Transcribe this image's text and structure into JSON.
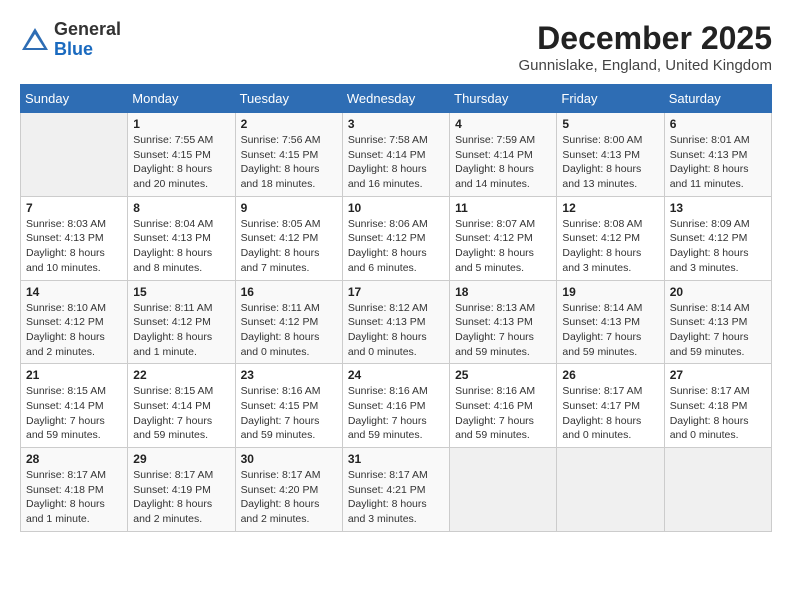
{
  "header": {
    "logo_line1": "General",
    "logo_line2": "Blue",
    "month": "December 2025",
    "location": "Gunnislake, England, United Kingdom"
  },
  "weekdays": [
    "Sunday",
    "Monday",
    "Tuesday",
    "Wednesday",
    "Thursday",
    "Friday",
    "Saturday"
  ],
  "weeks": [
    [
      {
        "day": "",
        "info": ""
      },
      {
        "day": "1",
        "info": "Sunrise: 7:55 AM\nSunset: 4:15 PM\nDaylight: 8 hours\nand 20 minutes."
      },
      {
        "day": "2",
        "info": "Sunrise: 7:56 AM\nSunset: 4:15 PM\nDaylight: 8 hours\nand 18 minutes."
      },
      {
        "day": "3",
        "info": "Sunrise: 7:58 AM\nSunset: 4:14 PM\nDaylight: 8 hours\nand 16 minutes."
      },
      {
        "day": "4",
        "info": "Sunrise: 7:59 AM\nSunset: 4:14 PM\nDaylight: 8 hours\nand 14 minutes."
      },
      {
        "day": "5",
        "info": "Sunrise: 8:00 AM\nSunset: 4:13 PM\nDaylight: 8 hours\nand 13 minutes."
      },
      {
        "day": "6",
        "info": "Sunrise: 8:01 AM\nSunset: 4:13 PM\nDaylight: 8 hours\nand 11 minutes."
      }
    ],
    [
      {
        "day": "7",
        "info": "Sunrise: 8:03 AM\nSunset: 4:13 PM\nDaylight: 8 hours\nand 10 minutes."
      },
      {
        "day": "8",
        "info": "Sunrise: 8:04 AM\nSunset: 4:13 PM\nDaylight: 8 hours\nand 8 minutes."
      },
      {
        "day": "9",
        "info": "Sunrise: 8:05 AM\nSunset: 4:12 PM\nDaylight: 8 hours\nand 7 minutes."
      },
      {
        "day": "10",
        "info": "Sunrise: 8:06 AM\nSunset: 4:12 PM\nDaylight: 8 hours\nand 6 minutes."
      },
      {
        "day": "11",
        "info": "Sunrise: 8:07 AM\nSunset: 4:12 PM\nDaylight: 8 hours\nand 5 minutes."
      },
      {
        "day": "12",
        "info": "Sunrise: 8:08 AM\nSunset: 4:12 PM\nDaylight: 8 hours\nand 3 minutes."
      },
      {
        "day": "13",
        "info": "Sunrise: 8:09 AM\nSunset: 4:12 PM\nDaylight: 8 hours\nand 3 minutes."
      }
    ],
    [
      {
        "day": "14",
        "info": "Sunrise: 8:10 AM\nSunset: 4:12 PM\nDaylight: 8 hours\nand 2 minutes."
      },
      {
        "day": "15",
        "info": "Sunrise: 8:11 AM\nSunset: 4:12 PM\nDaylight: 8 hours\nand 1 minute."
      },
      {
        "day": "16",
        "info": "Sunrise: 8:11 AM\nSunset: 4:12 PM\nDaylight: 8 hours\nand 0 minutes."
      },
      {
        "day": "17",
        "info": "Sunrise: 8:12 AM\nSunset: 4:13 PM\nDaylight: 8 hours\nand 0 minutes."
      },
      {
        "day": "18",
        "info": "Sunrise: 8:13 AM\nSunset: 4:13 PM\nDaylight: 7 hours\nand 59 minutes."
      },
      {
        "day": "19",
        "info": "Sunrise: 8:14 AM\nSunset: 4:13 PM\nDaylight: 7 hours\nand 59 minutes."
      },
      {
        "day": "20",
        "info": "Sunrise: 8:14 AM\nSunset: 4:13 PM\nDaylight: 7 hours\nand 59 minutes."
      }
    ],
    [
      {
        "day": "21",
        "info": "Sunrise: 8:15 AM\nSunset: 4:14 PM\nDaylight: 7 hours\nand 59 minutes."
      },
      {
        "day": "22",
        "info": "Sunrise: 8:15 AM\nSunset: 4:14 PM\nDaylight: 7 hours\nand 59 minutes."
      },
      {
        "day": "23",
        "info": "Sunrise: 8:16 AM\nSunset: 4:15 PM\nDaylight: 7 hours\nand 59 minutes."
      },
      {
        "day": "24",
        "info": "Sunrise: 8:16 AM\nSunset: 4:16 PM\nDaylight: 7 hours\nand 59 minutes."
      },
      {
        "day": "25",
        "info": "Sunrise: 8:16 AM\nSunset: 4:16 PM\nDaylight: 7 hours\nand 59 minutes."
      },
      {
        "day": "26",
        "info": "Sunrise: 8:17 AM\nSunset: 4:17 PM\nDaylight: 8 hours\nand 0 minutes."
      },
      {
        "day": "27",
        "info": "Sunrise: 8:17 AM\nSunset: 4:18 PM\nDaylight: 8 hours\nand 0 minutes."
      }
    ],
    [
      {
        "day": "28",
        "info": "Sunrise: 8:17 AM\nSunset: 4:18 PM\nDaylight: 8 hours\nand 1 minute."
      },
      {
        "day": "29",
        "info": "Sunrise: 8:17 AM\nSunset: 4:19 PM\nDaylight: 8 hours\nand 2 minutes."
      },
      {
        "day": "30",
        "info": "Sunrise: 8:17 AM\nSunset: 4:20 PM\nDaylight: 8 hours\nand 2 minutes."
      },
      {
        "day": "31",
        "info": "Sunrise: 8:17 AM\nSunset: 4:21 PM\nDaylight: 8 hours\nand 3 minutes."
      },
      {
        "day": "",
        "info": ""
      },
      {
        "day": "",
        "info": ""
      },
      {
        "day": "",
        "info": ""
      }
    ]
  ]
}
